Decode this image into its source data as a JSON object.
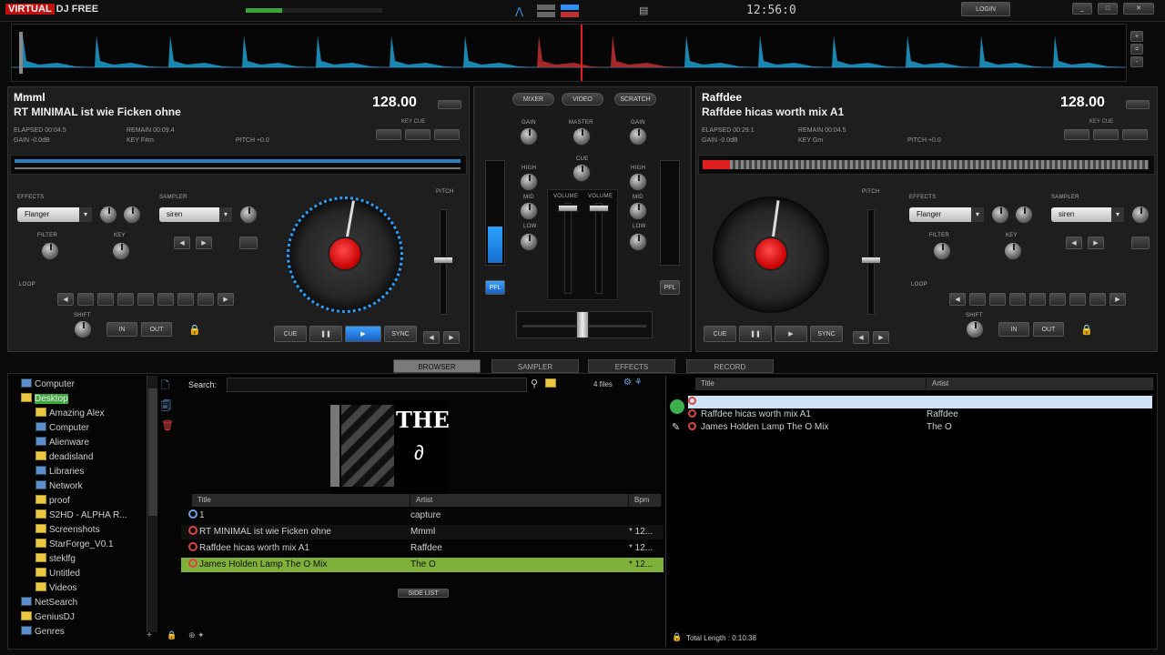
{
  "app": {
    "logo_text": "VIRTUAL DJ FREE",
    "logo_brand": "DJ FREE",
    "clock": "12:56:0",
    "login_button": "LOGIN"
  },
  "deck_left": {
    "artist": "Mmml",
    "title": "RT MINIMAL ist wie Ficken ohne",
    "bpm": "128.00",
    "elapsed_label": "ELAPSED 00:04.5",
    "remain_label": "REMAIN 00:09.4",
    "gain_label": "GAIN -0.0dB",
    "key_label": "KEY F#m",
    "pitch_label": "PITCH +0.0",
    "effects_label": "EFFECTS",
    "effect_value": "Flanger",
    "sampler_label": "SAMPLER",
    "sampler_value": "siren",
    "filter_label": "FILTER",
    "key_knob_label": "KEY",
    "loop_label": "LOOP",
    "shift_label": "SHIFT",
    "in_label": "IN",
    "out_label": "OUT",
    "cue_label": "CUE",
    "sync_label": "SYNC",
    "keycue_label": "KEY CUE",
    "pitch_slider_label": "PITCH"
  },
  "deck_right": {
    "artist": "Raffdee",
    "title": "Raffdee hicas worth mix A1",
    "bpm": "128.00",
    "elapsed_label": "ELAPSED 00:29.1",
    "remain_label": "REMAIN 00:04.5",
    "gain_label": "GAIN -0.0dB",
    "key_label": "KEY Gm",
    "pitch_label": "PITCH +0.0",
    "effects_label": "EFFECTS",
    "effect_value": "Flanger",
    "sampler_label": "SAMPLER",
    "sampler_value": "siren",
    "filter_label": "FILTER",
    "key_knob_label": "KEY",
    "loop_label": "LOOP",
    "shift_label": "SHIFT",
    "in_label": "IN",
    "out_label": "OUT",
    "cue_label": "CUE",
    "sync_label": "SYNC",
    "keycue_label": "KEY CUE",
    "pitch_slider_label": "PITCH"
  },
  "mixer": {
    "top_buttons": [
      "MIXER",
      "VIDEO",
      "SCRATCH"
    ],
    "gain_label": "GAIN",
    "high_label": "HIGH",
    "mid_label": "MID",
    "low_label": "LOW",
    "master_label": "MASTER",
    "headphones_label": "CUE",
    "volume_label": "VOLUME",
    "pfl_left": "PFL",
    "pfl_right": "PFL"
  },
  "tabs": [
    {
      "label": "BROWSER",
      "active": true
    },
    {
      "label": "SAMPLER",
      "active": false
    },
    {
      "label": "EFFECTS",
      "active": false
    },
    {
      "label": "RECORD",
      "active": false
    }
  ],
  "browser": {
    "search_label": "Search:",
    "file_count": "4 files",
    "cover_text": "THE",
    "columns": [
      "Title",
      "Artist",
      "Bpm"
    ],
    "rows": [
      {
        "title": "1",
        "artist": "capture",
        "bpm": ""
      },
      {
        "title": "RT MINIMAL ist wie Ficken ohne",
        "artist": "Mmml",
        "bpm": "* 12..."
      },
      {
        "title": "Raffdee hicas worth mix A1",
        "artist": "Raffdee",
        "bpm": "* 12..."
      },
      {
        "title": "James Holden Lamp The O Mix",
        "artist": "The O",
        "bpm": "* 12..."
      }
    ],
    "side_list_button": "SIDE LIST"
  },
  "tree": [
    "Computer",
    "Desktop",
    "Amazing Alex",
    "Computer",
    "Alienware",
    "deadisland",
    "Libraries",
    "Network",
    "proof",
    "S2HD - ALPHA R...",
    "Screenshots",
    "StarForge_V0.1",
    "steklfg",
    "Untitled",
    "Videos",
    "NetSearch",
    "GeniusDJ",
    "Genres"
  ],
  "playlist": {
    "columns": [
      "Title",
      "Artist"
    ],
    "rows": [
      {
        "title": "",
        "artist": ""
      },
      {
        "title": "Raffdee hicas worth mix A1",
        "artist": "Raffdee"
      },
      {
        "title": "James Holden Lamp The O Mix",
        "artist": "The O"
      }
    ],
    "total_length": "Total Length : 0:10:38"
  }
}
